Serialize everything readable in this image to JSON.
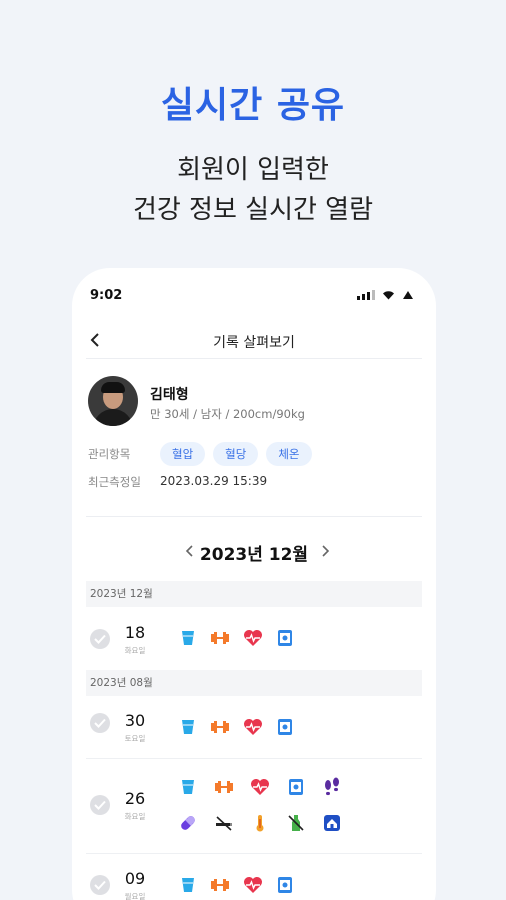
{
  "promo": {
    "title": "실시간 공유",
    "subtitle_line1": "회원이 입력한",
    "subtitle_line2": "건강 정보 실시간 열람"
  },
  "status_bar": {
    "time": "9:02"
  },
  "nav": {
    "title": "기록 살펴보기"
  },
  "profile": {
    "name": "김태형",
    "info": "만 30세 / 남자 / 200cm/90kg",
    "manage_label": "관리항목",
    "tags": [
      "혈압",
      "혈당",
      "체온"
    ],
    "recent_label": "최근측정일",
    "recent_value": "2023.03.29 15:39"
  },
  "month": {
    "title": "2023년 12월"
  },
  "sections": [
    {
      "header": "2023년 12월",
      "entries": [
        {
          "day": "18",
          "weekday": "화요일",
          "icons": [
            "water-cup-icon",
            "dumbbell-icon",
            "heart-rate-icon",
            "square-dot-icon"
          ]
        }
      ]
    },
    {
      "header": "2023년 08월",
      "entries": [
        {
          "day": "30",
          "weekday": "토요일",
          "icons": [
            "water-cup-icon",
            "dumbbell-icon",
            "heart-rate-icon",
            "square-dot-icon"
          ]
        },
        {
          "day": "26",
          "weekday": "화요일",
          "icons": [
            "water-cup-icon",
            "dumbbell-icon",
            "heart-rate-icon",
            "square-dot-icon",
            "footprints-icon",
            "pill-icon",
            "no-smoking-icon",
            "thermometer-icon",
            "no-drink-icon",
            "home-icon"
          ]
        },
        {
          "day": "09",
          "weekday": "월요일",
          "icons": [
            "water-cup-icon",
            "dumbbell-icon",
            "heart-rate-icon",
            "square-dot-icon"
          ]
        }
      ]
    }
  ],
  "colors": {
    "accent": "#2b63e3",
    "water": "#29a9e8",
    "exercise": "#f47a2b",
    "heart": "#e8364e",
    "square": "#2f86e6",
    "steps": "#5a2ca0",
    "pill": "#6a3ee0",
    "thermo": "#f2a12a",
    "drink": "#46b04a",
    "home": "#1f4fc4"
  }
}
